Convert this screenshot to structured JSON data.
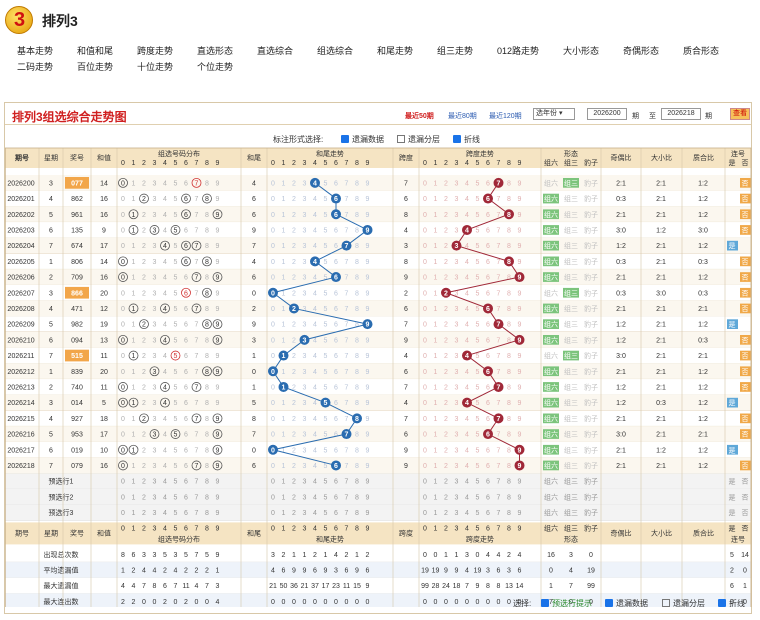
{
  "header": {
    "logo_text": "3",
    "title": "排列3",
    "colors": {
      "brand": "#e39b00",
      "accent": "#d02020"
    }
  },
  "nav": [
    [
      "基本走势",
      "和值和尾",
      "跨度走势",
      "直选形态",
      "直选综合",
      "组选综合",
      "和尾走势",
      "组三走势",
      "012路走势",
      "大小形态",
      "奇偶形态",
      "质合形态"
    ],
    [
      "二码走势",
      "百位走势",
      "十位走势",
      "个位走势"
    ]
  ],
  "panel": {
    "title": "排列3组选综合走势图",
    "links": [
      "最近50期",
      "最近80期",
      "最近120期"
    ],
    "year_select": "选年份",
    "from": "2026200",
    "to_label": "至",
    "to": "2026218",
    "period": "期",
    "query": "查看",
    "mark_label": "标注形式选择:",
    "mark_opts": [
      "遗漏数据",
      "遗漏分层",
      "折线"
    ]
  },
  "cols": {
    "issue": "期号",
    "week": "星期",
    "prize": "奖号",
    "sum": "和值",
    "dist": "组选号码分布",
    "tail": "和尾",
    "sumtrend": "和尾走势",
    "span": "跨度",
    "spantrend": "跨度走势",
    "shape": "形态",
    "z6": "组六",
    "z3": "组三",
    "bz": "豹子",
    "oe": "奇偶比",
    "bs": "大小比",
    "pc": "质合比",
    "lh": "连号",
    "yes": "是",
    "no": "否"
  },
  "rows": [
    {
      "issue": "2026200",
      "week": "3",
      "prize": "077",
      "sum": "14",
      "tail": "4",
      "span": "7",
      "shape": "z3",
      "oe": "2:1",
      "bs": "2:1",
      "pc": "1:2",
      "lh": "否",
      "hl": true
    },
    {
      "issue": "2026201",
      "week": "4",
      "prize": "862",
      "sum": "16",
      "tail": "6",
      "span": "6",
      "shape": "z6",
      "oe": "0:3",
      "bs": "2:1",
      "pc": "1:2",
      "lh": "否"
    },
    {
      "issue": "2026202",
      "week": "5",
      "prize": "961",
      "sum": "16",
      "tail": "6",
      "span": "8",
      "shape": "z6",
      "oe": "2:1",
      "bs": "2:1",
      "pc": "1:2",
      "lh": "否"
    },
    {
      "issue": "2026203",
      "week": "6",
      "prize": "135",
      "sum": "9",
      "tail": "9",
      "span": "4",
      "shape": "z6",
      "oe": "3:0",
      "bs": "1:2",
      "pc": "3:0",
      "lh": "否"
    },
    {
      "issue": "2026204",
      "week": "7",
      "prize": "674",
      "sum": "17",
      "tail": "7",
      "span": "3",
      "shape": "z6",
      "oe": "1:2",
      "bs": "2:1",
      "pc": "1:2",
      "lh": "是"
    },
    {
      "issue": "2026205",
      "week": "1",
      "prize": "806",
      "sum": "14",
      "tail": "4",
      "span": "8",
      "shape": "z6",
      "oe": "0:3",
      "bs": "2:1",
      "pc": "0:3",
      "lh": "否"
    },
    {
      "issue": "2026206",
      "week": "2",
      "prize": "709",
      "sum": "16",
      "tail": "6",
      "span": "9",
      "shape": "z6",
      "oe": "2:1",
      "bs": "2:1",
      "pc": "1:2",
      "lh": "否"
    },
    {
      "issue": "2026207",
      "week": "3",
      "prize": "866",
      "sum": "20",
      "tail": "0",
      "span": "2",
      "shape": "z3",
      "oe": "0:3",
      "bs": "3:0",
      "pc": "0:3",
      "lh": "否",
      "hl": true
    },
    {
      "issue": "2026208",
      "week": "4",
      "prize": "471",
      "sum": "12",
      "tail": "2",
      "span": "6",
      "shape": "z6",
      "oe": "2:1",
      "bs": "2:1",
      "pc": "2:1",
      "lh": "否"
    },
    {
      "issue": "2026209",
      "week": "5",
      "prize": "982",
      "sum": "19",
      "tail": "9",
      "span": "7",
      "shape": "z6",
      "oe": "1:2",
      "bs": "2:1",
      "pc": "1:2",
      "lh": "是"
    },
    {
      "issue": "2026210",
      "week": "6",
      "prize": "094",
      "sum": "13",
      "tail": "3",
      "span": "9",
      "shape": "z6",
      "oe": "1:2",
      "bs": "2:1",
      "pc": "0:3",
      "lh": "否"
    },
    {
      "issue": "2026211",
      "week": "7",
      "prize": "515",
      "sum": "11",
      "tail": "1",
      "span": "4",
      "shape": "z3",
      "oe": "3:0",
      "bs": "2:1",
      "pc": "2:1",
      "lh": "否",
      "hl": true
    },
    {
      "issue": "2026212",
      "week": "1",
      "prize": "839",
      "sum": "20",
      "tail": "0",
      "span": "6",
      "shape": "z6",
      "oe": "2:1",
      "bs": "2:1",
      "pc": "1:2",
      "lh": "否"
    },
    {
      "issue": "2026213",
      "week": "2",
      "prize": "740",
      "sum": "11",
      "tail": "1",
      "span": "7",
      "shape": "z6",
      "oe": "1:2",
      "bs": "2:1",
      "pc": "1:2",
      "lh": "否"
    },
    {
      "issue": "2026214",
      "week": "3",
      "prize": "014",
      "sum": "5",
      "tail": "5",
      "span": "4",
      "shape": "z6",
      "oe": "1:2",
      "bs": "0:3",
      "pc": "1:2",
      "lh": "是"
    },
    {
      "issue": "2026215",
      "week": "4",
      "prize": "927",
      "sum": "18",
      "tail": "8",
      "span": "7",
      "shape": "z6",
      "oe": "2:1",
      "bs": "2:1",
      "pc": "1:2",
      "lh": "否"
    },
    {
      "issue": "2026216",
      "week": "5",
      "prize": "953",
      "sum": "17",
      "tail": "7",
      "span": "6",
      "shape": "z6",
      "oe": "3:0",
      "bs": "2:1",
      "pc": "2:1",
      "lh": "否"
    },
    {
      "issue": "2026217",
      "week": "6",
      "prize": "019",
      "sum": "10",
      "tail": "0",
      "span": "9",
      "shape": "z6",
      "oe": "2:1",
      "bs": "1:2",
      "pc": "1:2",
      "lh": "是"
    },
    {
      "issue": "2026218",
      "week": "7",
      "prize": "079",
      "sum": "16",
      "tail": "6",
      "span": "9",
      "shape": "z6",
      "oe": "2:1",
      "bs": "2:1",
      "pc": "1:2",
      "lh": "否"
    }
  ],
  "pre": [
    "预选行1",
    "预选行2",
    "预选行3"
  ],
  "stats": [
    {
      "label": "出现总次数",
      "dist": [
        "8",
        "6",
        "3",
        "3",
        "5",
        "3",
        "5",
        "7",
        "5",
        "9"
      ],
      "tail": [
        "3",
        "2",
        "1",
        "1",
        "2",
        "1",
        "4",
        "2",
        "1",
        "2"
      ],
      "span": [
        "0",
        "0",
        "1",
        "1",
        "3",
        "0",
        "4",
        "4",
        "2",
        "4"
      ],
      "sh": [
        "16",
        "3",
        "0"
      ],
      "lh": [
        "5",
        "14"
      ]
    },
    {
      "label": "平均遗漏值",
      "dist": [
        "1",
        "2",
        "4",
        "4",
        "2",
        "4",
        "2",
        "2",
        "2",
        "1"
      ],
      "tail": [
        "4",
        "6",
        "9",
        "9",
        "6",
        "9",
        "3",
        "6",
        "9",
        "6"
      ],
      "span": [
        "19",
        "19",
        "9",
        "9",
        "4",
        "19",
        "3",
        "6",
        "3",
        "6"
      ],
      "sh": [
        "0",
        "4",
        "19"
      ],
      "lh": [
        "2",
        "0"
      ]
    },
    {
      "label": "最大遗漏值",
      "dist": [
        "4",
        "4",
        "7",
        "8",
        "6",
        "7",
        "11",
        "4",
        "7",
        "3"
      ],
      "tail": [
        "21",
        "50",
        "36",
        "21",
        "37",
        "17",
        "23",
        "11",
        "15",
        "9"
      ],
      "span": [
        "99",
        "28",
        "24",
        "18",
        "7",
        "9",
        "8",
        "8",
        "13",
        "14"
      ],
      "sh": [
        "1",
        "7",
        "99"
      ],
      "lh": [
        "6",
        "1"
      ]
    },
    {
      "label": "最大连出数",
      "dist": [
        "2",
        "2",
        "0",
        "0",
        "2",
        "0",
        "2",
        "0",
        "0",
        "4"
      ],
      "tail": [
        "0",
        "0",
        "0",
        "0",
        "0",
        "0",
        "0",
        "0",
        "0",
        "0"
      ],
      "span": [
        "0",
        "0",
        "0",
        "0",
        "0",
        "0",
        "0",
        "0",
        "0",
        "0"
      ],
      "sh": [
        "7",
        "0",
        "0"
      ],
      "lh": [
        "0",
        "0"
      ]
    }
  ],
  "footer": {
    "label": "选择:",
    "opts": [
      "预选行提示",
      "遗漏数据",
      "遗漏分层",
      "折线"
    ]
  }
}
